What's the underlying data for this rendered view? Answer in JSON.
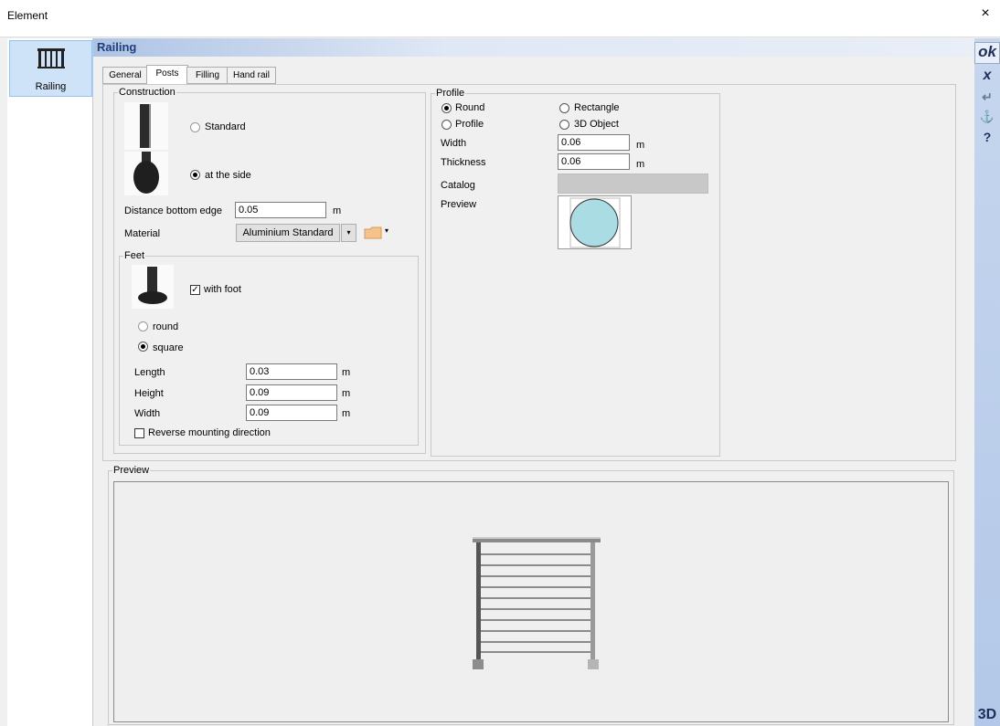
{
  "window": {
    "title": "Element",
    "close_symbol": "×"
  },
  "left_panel": {
    "item_label": "Railing"
  },
  "header": {
    "title": "Railing"
  },
  "right_bar": {
    "ok": "ok",
    "cancel": "x",
    "enter": "↵",
    "anchor": "⚓",
    "help": "?",
    "view3d": "3D"
  },
  "tabs": [
    {
      "label": "General"
    },
    {
      "label": "Posts"
    },
    {
      "label": "Filling"
    },
    {
      "label": "Hand rail"
    }
  ],
  "active_tab": "Posts",
  "construction": {
    "legend": "Construction",
    "standard_label": "Standard",
    "side_label": "at the side",
    "selected": "at the side",
    "distance_label": "Distance bottom edge",
    "distance_value": "0.05",
    "distance_unit": "m",
    "material_label": "Material",
    "material_value": "Aluminium Standard",
    "folder_color": "#f6c48a"
  },
  "feet": {
    "legend": "Feet",
    "with_foot_label": "with foot",
    "with_foot_checked": true,
    "round_label": "round",
    "square_label": "square",
    "selected": "square",
    "length_label": "Length",
    "length_value": "0.03",
    "height_label": "Height",
    "height_value": "0.09",
    "width_label": "Width",
    "width_value": "0.09",
    "unit": "m",
    "reverse_label": "Reverse mounting direction",
    "reverse_checked": false
  },
  "profile": {
    "legend": "Profile",
    "round_label": "Round",
    "rectangle_label": "Rectangle",
    "profile_label": "Profile",
    "object_label": "3D Object",
    "selected": "Round",
    "width_label": "Width",
    "width_value": "0.06",
    "thickness_label": "Thickness",
    "thickness_value": "0.06",
    "unit": "m",
    "catalog_label": "Catalog",
    "preview_label": "Preview",
    "preview_fill": "#a9dde3"
  },
  "preview": {
    "legend": "Preview"
  }
}
